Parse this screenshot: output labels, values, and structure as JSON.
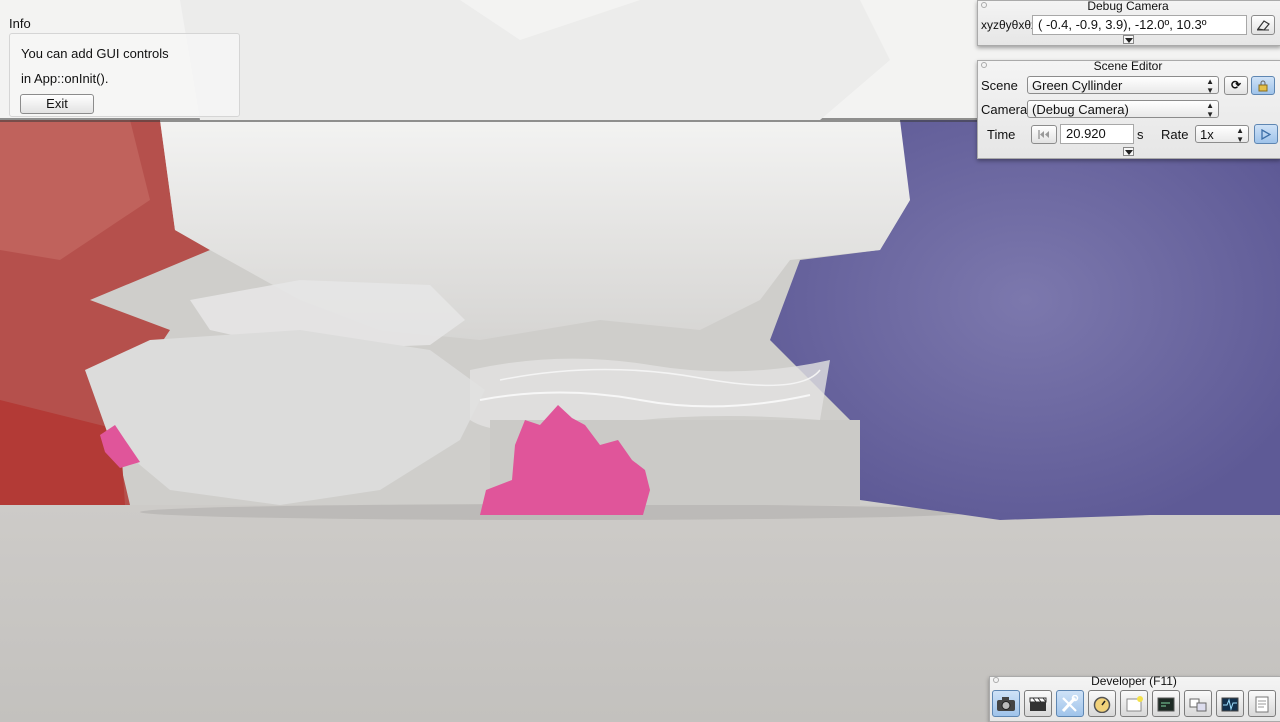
{
  "info": {
    "title": "Info",
    "line1": "You can add GUI controls",
    "line2": "in App::onInit().",
    "exit_label": "Exit"
  },
  "debug_camera": {
    "title": "Debug Camera",
    "xyz_label": "xyzθyθxθz",
    "coords_value": "( -0.4,  -0.9,   3.9), -12.0º,  10.3º"
  },
  "scene_editor": {
    "title": "Scene Editor",
    "scene_label": "Scene",
    "scene_value": "Green Cyllinder",
    "camera_label": "Camera",
    "camera_value": "(Debug Camera)",
    "time_label": "Time",
    "time_value": "20.920",
    "time_unit": "s",
    "rate_label": "Rate",
    "rate_value": "1x"
  },
  "developer": {
    "title": "Developer (F11)",
    "tools": [
      {
        "icon": "camera-icon"
      },
      {
        "icon": "clapperboard-icon"
      },
      {
        "icon": "wrench-screwdriver-icon"
      },
      {
        "icon": "stopwatch-icon"
      },
      {
        "icon": "new-window-icon"
      },
      {
        "icon": "terminal-icon"
      },
      {
        "icon": "windows-icon"
      },
      {
        "icon": "profiler-icon"
      },
      {
        "icon": "notes-icon"
      }
    ]
  },
  "colors": {
    "selected_tool": "#9fc3ea",
    "pink_plant": "#e0559a",
    "red_wall": "#b94a48",
    "blue_wall": "#6f6aa3"
  }
}
